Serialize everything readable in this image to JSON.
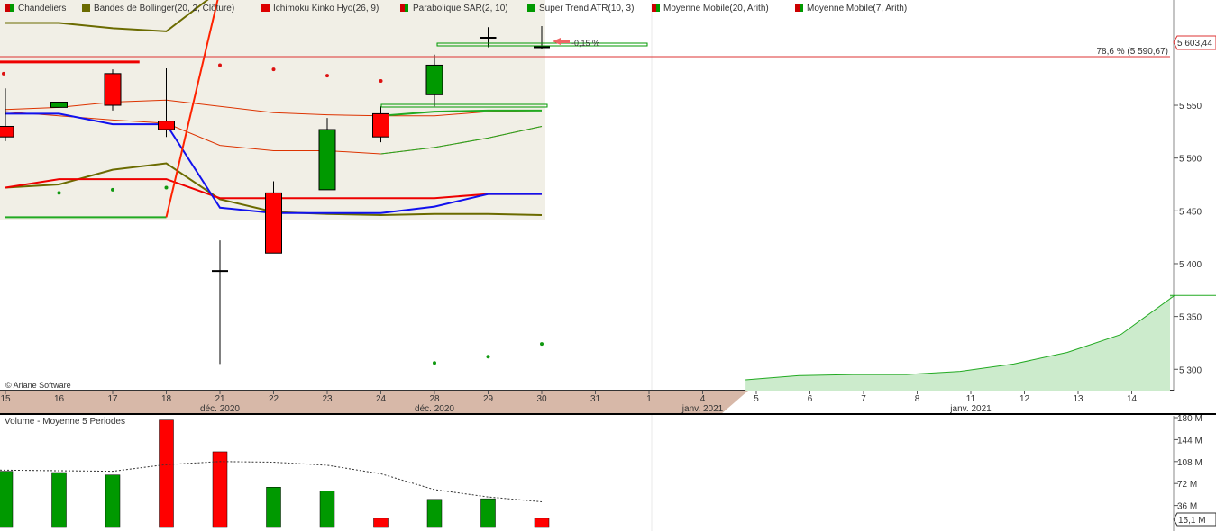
{
  "legend": [
    {
      "label": "Chandeliers",
      "color": "#cc0000",
      "color2": "#009900"
    },
    {
      "label": "Bandes de Bollinger(20, 2, Clôture)",
      "color": "#6b6b00"
    },
    {
      "label": "Ichimoku Kinko Hyo(26, 9)",
      "color": "#dd0000"
    },
    {
      "label": "Parabolique SAR(2, 10)",
      "color": "#cc0000",
      "color2": "#009900"
    },
    {
      "label": "Super Trend ATR(10, 3)",
      "color": "#009900"
    },
    {
      "label": "Moyenne Mobile(20, Arith)",
      "color": "#cc0000",
      "color2": "#009900"
    },
    {
      "label": "Moyenne Mobile(7, Arith)",
      "color": "#cc0000",
      "color2": "#009900"
    }
  ],
  "copyright": "© Ariane Software",
  "price_tag": "5 603,44",
  "fib_label": "78,6 % (5 590,67)",
  "pct_label": "-0,15 %",
  "volume_title": "Volume  - Moyenne 5 Periodes",
  "volume_tag": "15,1 M",
  "colors": {
    "up": "#009900",
    "down": "#ff0000",
    "cloud_fill": "#ccebcc",
    "dates_band": "#d7b8a8"
  },
  "chart_data": [
    {
      "type": "candlestick",
      "title": "",
      "dates": [
        "15",
        "16",
        "17",
        "18",
        "21",
        "22",
        "23",
        "24",
        "28",
        "29",
        "30"
      ],
      "month_labels": [
        {
          "at": "21",
          "text": "déc. 2020"
        },
        {
          "at": "28",
          "text": "déc. 2020"
        },
        {
          "at": "4",
          "text": "janv. 2021"
        },
        {
          "at": "11",
          "text": "janv. 2021"
        }
      ],
      "future_dates": [
        "31",
        "1",
        "4",
        "5",
        "6",
        "7",
        "8",
        "11",
        "12",
        "13",
        "14"
      ],
      "ohlc": [
        [
          5530,
          5566,
          5516,
          5520
        ],
        [
          5548,
          5589,
          5514,
          5553
        ],
        [
          5580,
          5584,
          5545,
          5550
        ],
        [
          5535,
          5585,
          5520,
          5527
        ],
        [
          5393,
          5422,
          5305,
          5393
        ],
        [
          5467,
          5478,
          5410,
          5410
        ],
        [
          5470,
          5538,
          5470,
          5527
        ],
        [
          5542,
          5549,
          5515,
          5520
        ],
        [
          5560,
          5598,
          5549,
          5588
        ],
        [
          5614,
          5624,
          5605,
          5614
        ],
        [
          5605,
          5625,
          5603,
          5604
        ]
      ],
      "bollinger_upper": [
        5628,
        5628,
        5623,
        5620,
        5659,
        5659,
        5659,
        5659,
        5659,
        5659
      ],
      "bollinger_middle": [
        5546,
        5548,
        5553,
        5555,
        5549,
        5543,
        5541,
        5540,
        5540,
        5544,
        5545
      ],
      "bollinger_lower": [
        5472,
        5475,
        5489,
        5495,
        5461,
        5449,
        5447,
        5446,
        5447,
        5447,
        5446
      ],
      "tenkan": [
        5542,
        5542,
        5532,
        5532,
        5453,
        5448,
        5448,
        5448,
        5454,
        5466,
        5466
      ],
      "kijun": [
        5472,
        5480,
        5480,
        5480,
        5462,
        5462,
        5462,
        5462,
        5462,
        5466,
        5466
      ],
      "ichimoku_red_early": [
        5590
      ],
      "senkou_lower_red": [
        5544,
        5540,
        5536,
        5533,
        5512,
        5507,
        5507,
        5504,
        5510,
        5519,
        5530
      ],
      "sar": [
        5580,
        5467,
        5470,
        5472,
        5588,
        5584,
        5578,
        5573,
        5306,
        5312,
        5324
      ],
      "sar_up": [
        false,
        true,
        true,
        true,
        false,
        false,
        false,
        false,
        true,
        true,
        true
      ],
      "supertrend_green": [
        5444,
        5444,
        5444,
        5444
      ],
      "supertrend_red_spike": [
        5444,
        5659
      ],
      "future_cloud": [
        5290,
        5294,
        5295,
        5295,
        5298,
        5305,
        5316,
        5333,
        5370,
        5370
      ],
      "ylim": [
        5290,
        5660
      ],
      "yticks": [
        5300,
        5350,
        5400,
        5450,
        5500,
        5550
      ],
      "ytick_labels": [
        "5 300",
        "5 350",
        "5 400",
        "5 450",
        "5 500",
        "5 550"
      ]
    },
    {
      "type": "bar",
      "title": "Volume  - Moyenne 5 Periodes",
      "categories": [
        "15",
        "16",
        "17",
        "18",
        "21",
        "22",
        "23",
        "24",
        "28",
        "29",
        "30"
      ],
      "values": [
        92,
        90,
        86,
        176,
        124,
        66,
        60,
        15,
        46,
        47,
        15
      ],
      "up": [
        true,
        true,
        true,
        false,
        false,
        true,
        true,
        false,
        true,
        true,
        false
      ],
      "moving_average": [
        94,
        93,
        92,
        103,
        108,
        107,
        102,
        88,
        62,
        50,
        42
      ],
      "ylim": [
        0,
        180
      ],
      "yticks": [
        36,
        72,
        108,
        144,
        180
      ],
      "ytick_labels": [
        "36 M",
        "72 M",
        "108 M",
        "144 M",
        "180 M"
      ],
      "unit": "M"
    }
  ]
}
